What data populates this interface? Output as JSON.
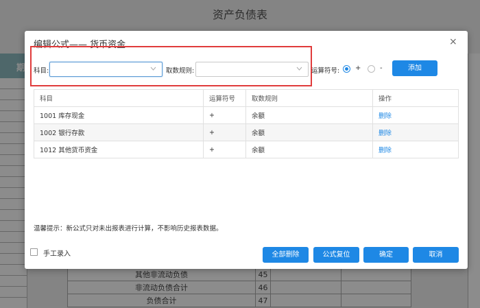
{
  "background": {
    "title": "资产负债表",
    "left_header": "期",
    "rows": [
      {
        "item": "其他非流动负债",
        "line": "45"
      },
      {
        "item": "非流动负债合计",
        "line": "46"
      },
      {
        "item": "负债合计",
        "line": "47"
      }
    ]
  },
  "dialog": {
    "title": "编辑公式—— 货币资金",
    "close_glyph": "×",
    "form": {
      "subject_label": "科目:",
      "subject_value": "",
      "rule_label": "取数规则:",
      "rule_value": "",
      "operator_label": "运算符号:",
      "operator_plus": "+",
      "operator_minus": "-",
      "selected_operator": "+",
      "add_label": "添加"
    },
    "table": {
      "headers": [
        "科目",
        "运算符号",
        "取数规则",
        "操作"
      ],
      "rows": [
        {
          "subject": "1001 库存现金",
          "operator": "+",
          "rule": "余额",
          "action": "删除"
        },
        {
          "subject": "1002 银行存款",
          "operator": "+",
          "rule": "余额",
          "action": "删除"
        },
        {
          "subject": "1012 其他货币资金",
          "operator": "+",
          "rule": "余额",
          "action": "删除"
        }
      ]
    },
    "hint": "温馨提示：新公式只对未出报表进行计算，不影响历史报表数据。",
    "manual_entry_label": "手工录入",
    "buttons": {
      "delete_all": "全部删除",
      "reset_formula": "公式复位",
      "confirm": "确定",
      "cancel": "取消"
    }
  },
  "colors": {
    "primary": "#1e88e5",
    "highlight_box": "#e03a3a",
    "header_teal": "#8fbcc2"
  }
}
